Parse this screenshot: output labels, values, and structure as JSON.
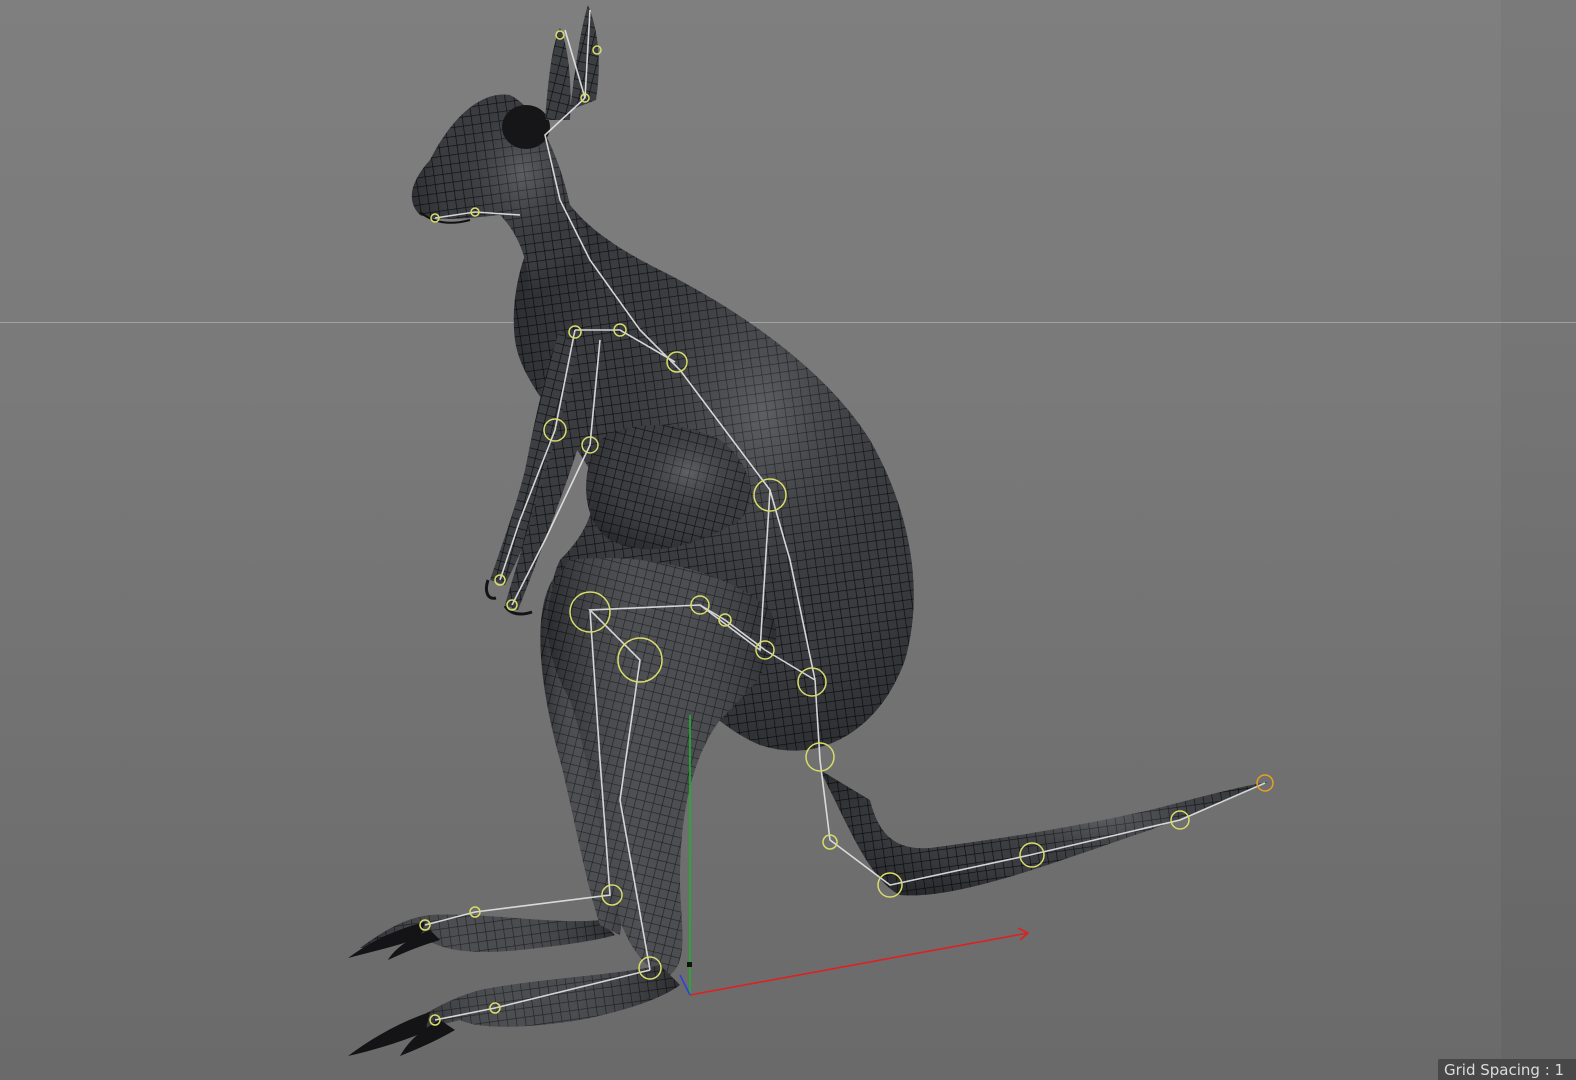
{
  "viewport": {
    "hud_text": "Grid Spacing : 1",
    "colors": {
      "background": "#7a7a7a",
      "mesh_fill": "#3a3c40",
      "wire": "#0c0c0e",
      "bone": "#e6e6e6",
      "joint": "#d8dc6a",
      "axis_x": "#e02020",
      "axis_y": "#20b030",
      "axis_z": "#3040e0"
    }
  },
  "object": {
    "type": "rigged-mesh",
    "subject": "kangaroo"
  }
}
